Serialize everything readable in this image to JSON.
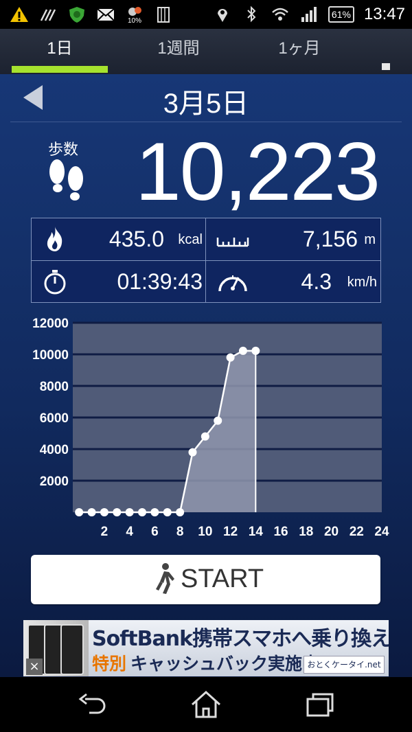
{
  "status_bar": {
    "battery": "61%",
    "time": "13:47",
    "rain_percent": "10%"
  },
  "tabs": [
    {
      "label": "1日",
      "active": true
    },
    {
      "label": "1週間",
      "active": false
    },
    {
      "label": "1ヶ月",
      "active": false
    }
  ],
  "date": "3月5日",
  "steps": {
    "label": "歩数",
    "value": "10,223"
  },
  "stats": {
    "calories": {
      "value": "435.0",
      "unit": "kcal"
    },
    "distance": {
      "value": "7,156",
      "unit": "m"
    },
    "duration": {
      "value": "01:39:43"
    },
    "speed": {
      "value": "4.3",
      "unit": "km/h"
    }
  },
  "chart_data": {
    "type": "area",
    "x": [
      0,
      1,
      2,
      3,
      4,
      5,
      6,
      7,
      8,
      9,
      10,
      11,
      12,
      13,
      14
    ],
    "values": [
      0,
      0,
      0,
      0,
      0,
      0,
      0,
      0,
      0,
      3800,
      4800,
      5800,
      9800,
      10223,
      10223
    ],
    "x_ticks": [
      "2",
      "4",
      "6",
      "8",
      "10",
      "12",
      "14",
      "16",
      "18",
      "20",
      "22",
      "24"
    ],
    "y_ticks": [
      "2000",
      "4000",
      "6000",
      "8000",
      "10000",
      "12000"
    ],
    "xlim": [
      -0.5,
      24
    ],
    "ylim": [
      0,
      12000
    ],
    "grid": true
  },
  "start_button": {
    "label": "START"
  },
  "ad": {
    "line1": "SoftBank携帯スマホへ乗り換え",
    "line2_highlight": "特別",
    "line2": "キャッシュバック実施中",
    "logo": "おとくケータイ.net"
  },
  "colors": {
    "accent": "#a6e22e",
    "background": "#173776"
  }
}
